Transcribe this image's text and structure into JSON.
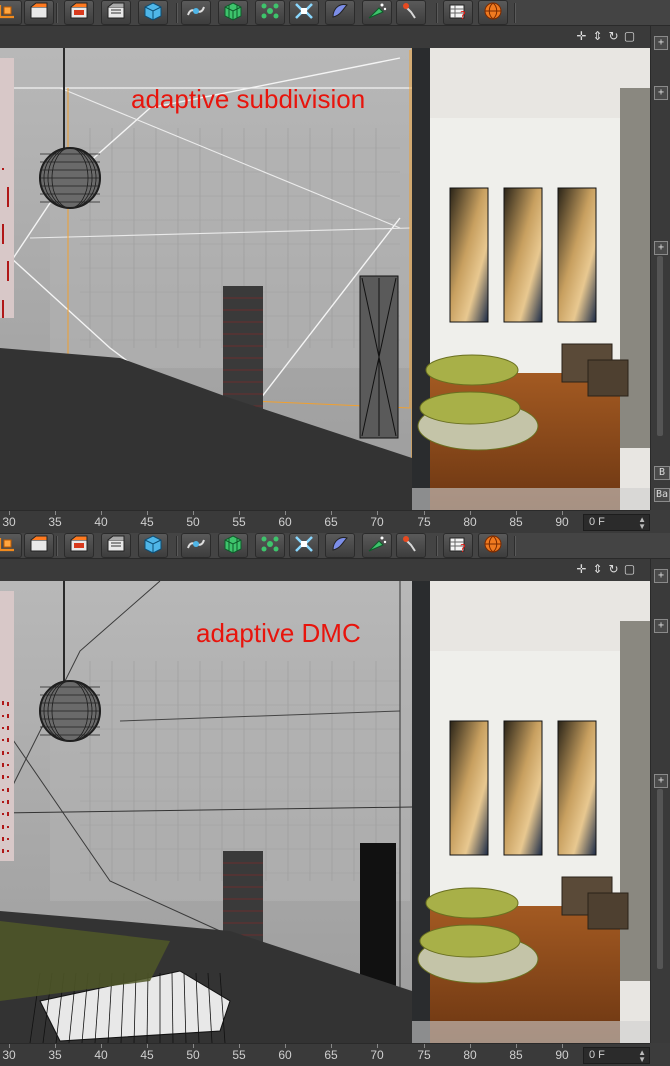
{
  "panes": [
    {
      "id": "top",
      "label": "adaptive subdivision",
      "frame_field": "0 F",
      "ticks": [
        "30",
        "35",
        "40",
        "45",
        "50",
        "55",
        "60",
        "65",
        "70",
        "75",
        "80",
        "85",
        "90"
      ],
      "sidebar_letters": [
        "B",
        "Ba"
      ]
    },
    {
      "id": "bottom",
      "label": "adaptive DMC",
      "frame_field": "0 F",
      "ticks": [
        "30",
        "35",
        "40",
        "45",
        "50",
        "55",
        "60",
        "65",
        "70",
        "75",
        "80",
        "85",
        "90"
      ],
      "sidebar_letters": []
    }
  ],
  "toolbar": {
    "buttons": [
      {
        "icon": "axis-icon"
      },
      {
        "icon": "render-view-icon"
      },
      {
        "icon": "render-picture-viewer-icon"
      },
      {
        "icon": "render-settings-icon"
      },
      {
        "icon": "cube-primitive-icon"
      },
      {
        "icon": "spline-pen-icon"
      },
      {
        "icon": "subdivision-surface-icon"
      },
      {
        "icon": "cloner-icon"
      },
      {
        "icon": "deformer-icon"
      },
      {
        "icon": "scene-object-icon"
      },
      {
        "icon": "particle-icon"
      },
      {
        "icon": "camera-icon"
      },
      {
        "icon": "tag-help-icon"
      },
      {
        "icon": "globe-icon"
      }
    ]
  },
  "nav_icons": [
    "move-view-icon",
    "zoom-view-icon",
    "rotate-view-icon",
    "toggle-view-icon"
  ],
  "colors": {
    "label_red": "#e8140c",
    "ui_dark": "#3a3a3a",
    "render_floor": "#8a4a1c",
    "cushion_green": "#a8b048"
  }
}
